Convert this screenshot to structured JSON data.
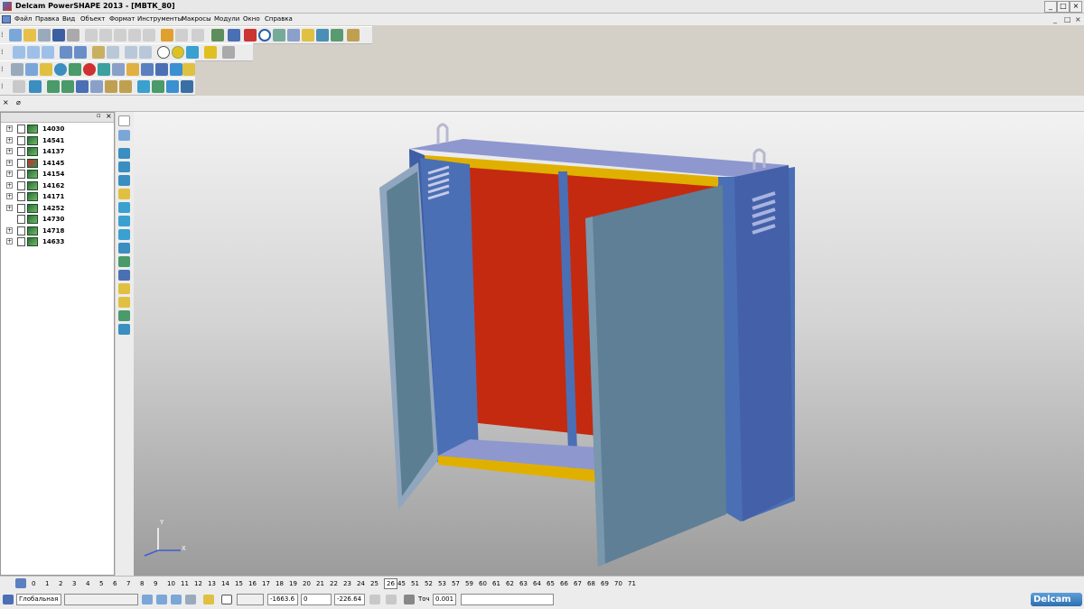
{
  "window": {
    "title": "Delcam PowerSHAPE 2013 - [МВТК_80]",
    "minimize": "_",
    "restore": "□",
    "close": "×"
  },
  "menu": [
    "Файл",
    "Правка",
    "Вид",
    "Объект",
    "Формат",
    "Инструменты",
    "Макросы",
    "Модули",
    "Окно",
    "Справка"
  ],
  "mdi": {
    "minimize": "_",
    "restore": "□",
    "close": "×"
  },
  "tree": {
    "items": [
      {
        "label": "14030",
        "flag": false,
        "expand": true
      },
      {
        "label": "14541",
        "flag": false,
        "expand": true
      },
      {
        "label": "14137",
        "flag": false,
        "expand": true
      },
      {
        "label": "14145",
        "flag": true,
        "expand": true
      },
      {
        "label": "14154",
        "flag": false,
        "expand": true
      },
      {
        "label": "14162",
        "flag": false,
        "expand": true
      },
      {
        "label": "14171",
        "flag": false,
        "expand": true
      },
      {
        "label": "14252",
        "flag": false,
        "expand": true
      },
      {
        "label": "14730",
        "flag": false,
        "expand": false
      },
      {
        "label": "14718",
        "flag": false,
        "expand": true
      },
      {
        "label": "14633",
        "flag": false,
        "expand": true
      }
    ]
  },
  "axis": {
    "y_label": "Y",
    "x_label": "X"
  },
  "numbers": [
    "0",
    "1",
    "2",
    "3",
    "4",
    "5",
    "6",
    "7",
    "8",
    "9",
    "10",
    "11",
    "12",
    "13",
    "14",
    "15",
    "16",
    "17",
    "18",
    "19",
    "20",
    "21",
    "22",
    "23",
    "24",
    "25",
    "26",
    "45",
    "51",
    "52",
    "53",
    "57",
    "59",
    "60",
    "61",
    "62",
    "63",
    "64",
    "65",
    "66",
    "67",
    "68",
    "69",
    "70",
    "71"
  ],
  "active_number": "26",
  "status": {
    "workplane": "Глобальная",
    "x": "-1663.6",
    "y": "0",
    "z": "-226.64",
    "tolerance_label": "Точ",
    "tolerance": "0.001",
    "logo": "Delcam"
  },
  "colors": {
    "cabinet_blue": "#4a6fb5",
    "door_grey": "#5f7f96",
    "interior_red": "#c42a0f",
    "trim_yellow": "#e0b000"
  }
}
